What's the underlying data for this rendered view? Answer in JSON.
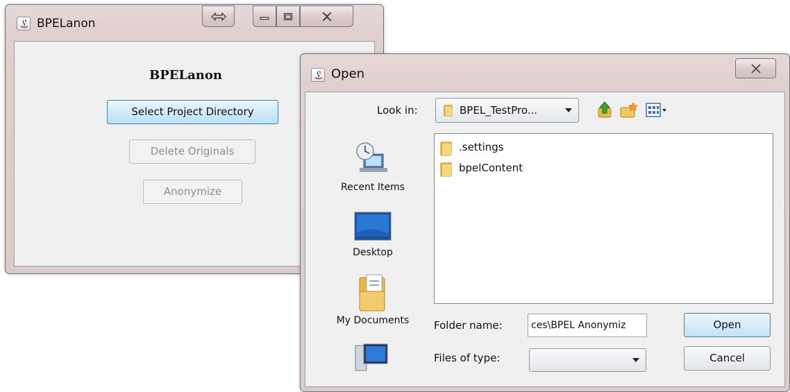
{
  "app_window": {
    "title": "BPELanon",
    "heading": "BPELanon",
    "buttons": {
      "select_project": "Select Project Directory",
      "delete_originals": "Delete Originals",
      "anonymize": "Anonymize"
    }
  },
  "open_dialog": {
    "title": "Open",
    "look_in_label": "Look in:",
    "look_in_value": "BPEL_TestPro...",
    "places": [
      {
        "label": "Recent Items",
        "icon": "recent-items-icon"
      },
      {
        "label": "Desktop",
        "icon": "desktop-icon"
      },
      {
        "label": "My Documents",
        "icon": "my-documents-icon"
      },
      {
        "label": "",
        "icon": "computer-icon"
      }
    ],
    "files": [
      {
        "name": ".settings",
        "icon": "folder-icon"
      },
      {
        "name": "bpelContent",
        "icon": "folder-icon"
      }
    ],
    "folder_name_label": "Folder name:",
    "folder_name_value": "ces\\BPEL Anonymiz",
    "files_of_type_label": "Files of type:",
    "files_of_type_value": "",
    "open_button": "Open",
    "cancel_button": "Cancel"
  },
  "colors": {
    "title_bar": "#e0cfcf",
    "client_bg": "#f0f0f0",
    "selected_button": "#bde0f6",
    "folder": "#e8b94a"
  }
}
